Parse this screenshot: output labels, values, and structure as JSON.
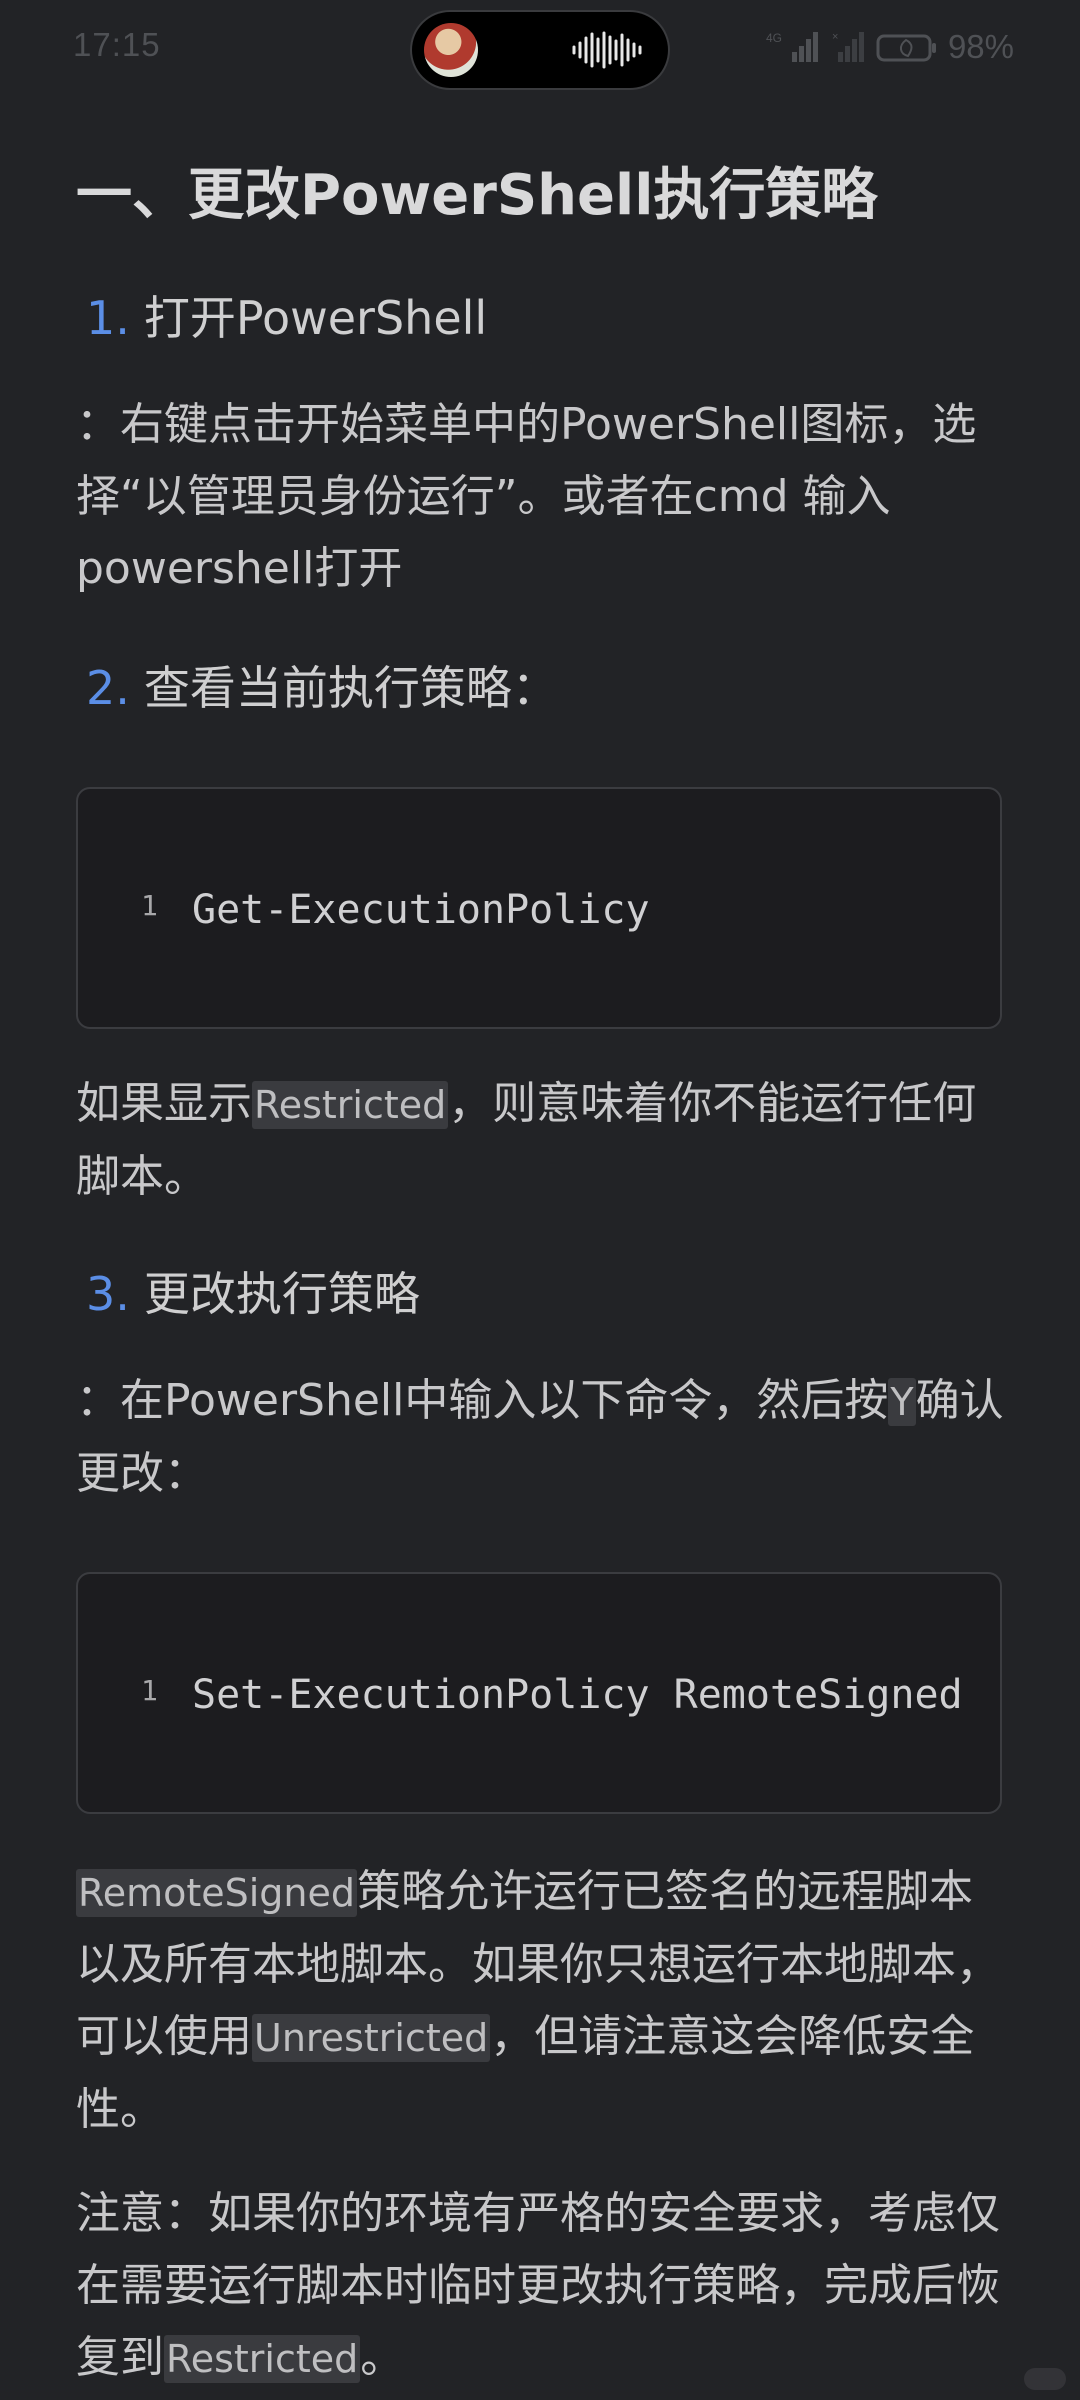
{
  "status_bar": {
    "time": "17:15",
    "network": "4G",
    "battery": "98%"
  },
  "article": {
    "heading": "一、更改PowerShell执行策略",
    "steps": [
      {
        "num": "1.",
        "label": "打开PowerShell"
      },
      {
        "num": "2.",
        "label": "查看当前执行策略："
      },
      {
        "num": "3.",
        "label": "更改执行策略"
      }
    ],
    "p1": "：右键点击开始菜单中的PowerShell图标，选择“以管理员身份运行”。或者在cmd 输入powershell打开",
    "code1": {
      "line": "1",
      "text": "Get-ExecutionPolicy"
    },
    "p2": {
      "a": "如果显示",
      "code": "Restricted",
      "b": "，则意味着你不能运行任何脚本。"
    },
    "p3": {
      "a": "：在PowerShell中输入以下命令，然后按",
      "code": "Y",
      "b": "确认更改："
    },
    "code2": {
      "line": "1",
      "text": "Set-ExecutionPolicy RemoteSigned"
    },
    "p4": {
      "code1": "RemoteSigned",
      "a": "策略允许运行已签名的远程脚本以及所有本地脚本。如果你只想运行本地脚本，可以使用",
      "code2": "Unrestricted",
      "b": "，但请注意这会降低安全性。"
    },
    "p5": {
      "a": "注意：如果你的环境有严格的安全要求，考虑仅在需要运行脚本时临时更改执行策略，完成后恢复到",
      "code": "Restricted",
      "b": "。"
    }
  }
}
